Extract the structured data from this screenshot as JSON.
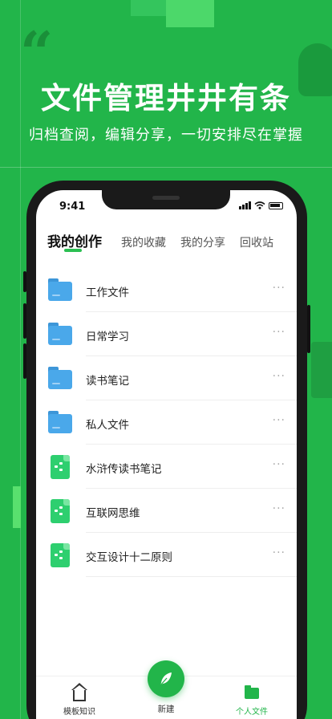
{
  "promo": {
    "headline": "文件管理井井有条",
    "subline": "归档查阅，编辑分享，一切安排尽在掌握"
  },
  "status_bar": {
    "time": "9:41"
  },
  "tabs": [
    {
      "label": "我的创作",
      "active": true
    },
    {
      "label": "我的收藏",
      "active": false
    },
    {
      "label": "我的分享",
      "active": false
    },
    {
      "label": "回收站",
      "active": false
    }
  ],
  "files": [
    {
      "name": "工作文件",
      "icon": "folder-icon",
      "more": "···"
    },
    {
      "name": "日常学习",
      "icon": "folder-icon",
      "more": "···"
    },
    {
      "name": "读书笔记",
      "icon": "folder-icon",
      "more": "···"
    },
    {
      "name": "私人文件",
      "icon": "folder-icon",
      "more": "···"
    },
    {
      "name": "水浒传读书笔记",
      "icon": "mindmap-file-icon",
      "more": "···"
    },
    {
      "name": "互联网思维",
      "icon": "mindmap-file-icon",
      "more": "···"
    },
    {
      "name": "交互设计十二原则",
      "icon": "mindmap-file-icon",
      "more": "···"
    }
  ],
  "bottom_nav": {
    "templates_label": "模板知识",
    "new_label": "新建",
    "personal_label": "个人文件"
  },
  "colors": {
    "brand_green": "#22b54a",
    "folder_blue": "#4aa8ea",
    "mindmap_green": "#2ecf6f"
  }
}
